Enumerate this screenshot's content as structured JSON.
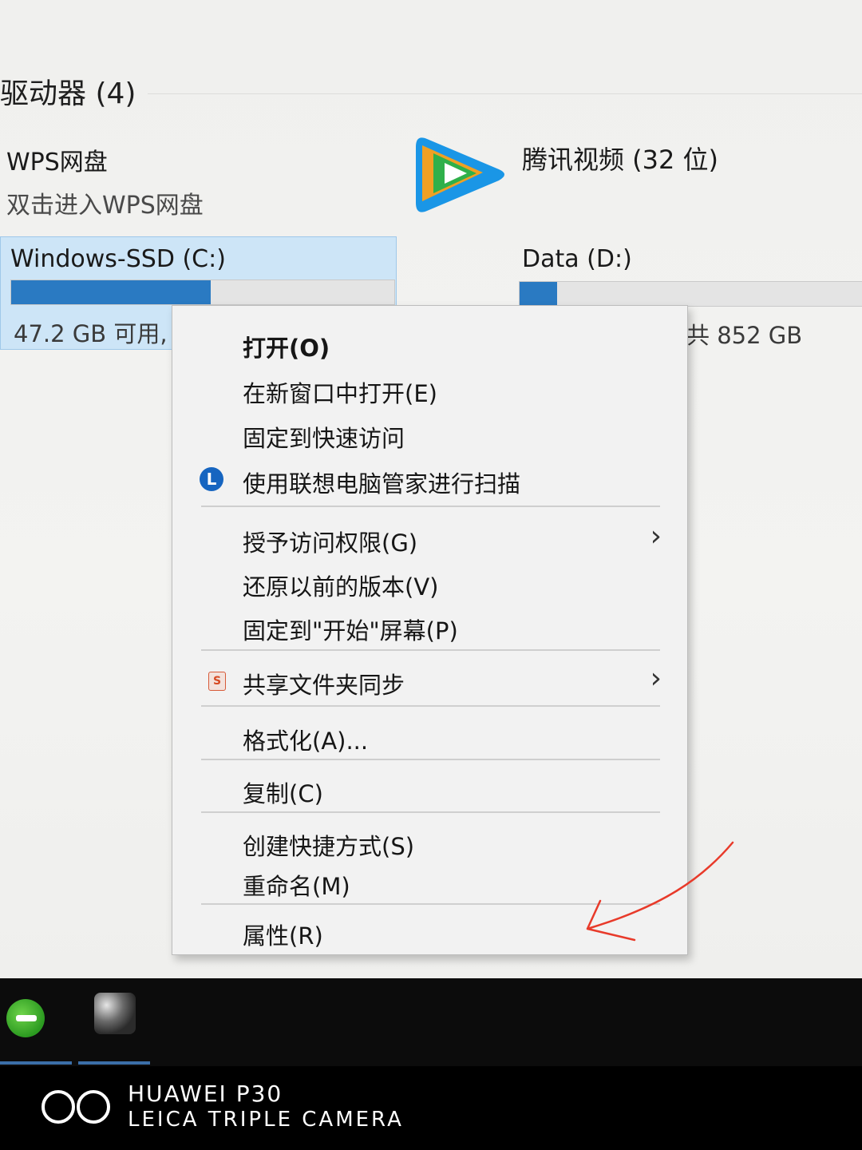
{
  "explorer": {
    "section_header": "驱动器 (4)",
    "wps": {
      "name": "WPS网盘",
      "subtitle": "双击进入WPS网盘"
    },
    "tencent": {
      "label": "腾讯视频 (32 位)",
      "icon": "tencent-video-icon"
    },
    "drive_c": {
      "name": "Windows-SSD (C:)",
      "free_text": "47.2 GB 可用,",
      "used_fraction": 0.52,
      "bar_color": "#2a7ac2"
    },
    "drive_d": {
      "name": "Data (D:)",
      "total_text": "共 852 GB",
      "used_fraction": 0.11,
      "bar_color": "#2a7ac2"
    }
  },
  "context_menu": {
    "open": "打开(O)",
    "open_new_window": "在新窗口中打开(E)",
    "pin_quick_access": "固定到快速访问",
    "lenovo_scan": "使用联想电脑管家进行扫描",
    "grant_access": "授予访问权限(G)",
    "restore_versions": "还原以前的版本(V)",
    "pin_start": "固定到\"开始\"屏幕(P)",
    "sync_shared_folder": "共享文件夹同步",
    "format": "格式化(A)...",
    "copy": "复制(C)",
    "create_shortcut": "创建快捷方式(S)",
    "rename": "重命名(M)",
    "properties": "属性(R)",
    "submenu_arrow": "›",
    "lenovo_icon": "lenovo-manager-icon",
    "wps_icon": "wps-sync-icon"
  },
  "annotation": {
    "color": "#e83a2a",
    "shape": "red-arrow-pointing-to-properties"
  },
  "taskbar": {
    "apps": [
      "green-app-icon",
      "photo-app-icon"
    ]
  },
  "watermark": {
    "line1": "HUAWEI P30",
    "line2": "LEICA TRIPLE CAMERA"
  }
}
